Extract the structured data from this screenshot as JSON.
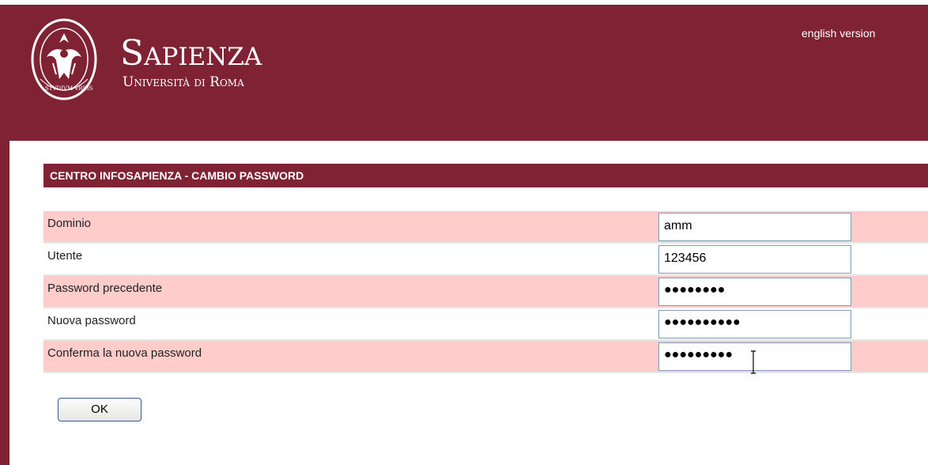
{
  "header": {
    "brand_name": "Sapienza",
    "brand_subtitle": "Università di Roma",
    "seal_motto": "STVDIVM VRBIS",
    "language_link": "english version"
  },
  "section": {
    "title": "CENTRO INFOSAPIENZA - CAMBIO PASSWORD"
  },
  "form": {
    "rows": [
      {
        "label": "Dominio",
        "value": "amm"
      },
      {
        "label": "Utente",
        "value": "123456"
      },
      {
        "label": "Password precedente",
        "value": "●●●●●●●●"
      },
      {
        "label": "Nuova password",
        "value": "●●●●●●●●●●"
      },
      {
        "label": "Conferma la nuova password",
        "value": "●●●●●●●●●"
      }
    ],
    "submit_label": "OK"
  },
  "colors": {
    "brand": "#7f2233",
    "row_alt": "#ffcccc"
  }
}
